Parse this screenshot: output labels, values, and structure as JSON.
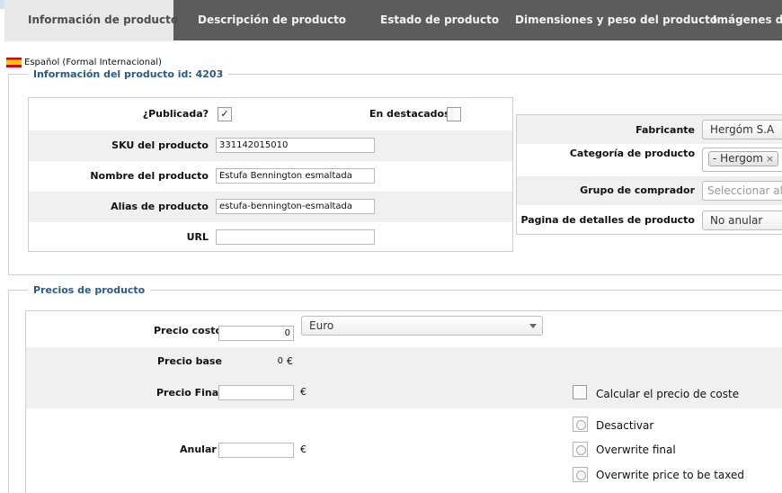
{
  "tabs": [
    {
      "label": "Información de producto",
      "active": true
    },
    {
      "label": "Descripción de producto",
      "active": false
    },
    {
      "label": "Estado de producto",
      "active": false
    },
    {
      "label": "Dimensiones y peso del producto",
      "active": false
    },
    {
      "label": "Imágenes de",
      "active": false
    }
  ],
  "language": {
    "flag_icon": "spain-flag-icon",
    "label": "Español (Formal Internacional)"
  },
  "product_info": {
    "legend": "Información del producto id: 4203",
    "published_label": "¿Publicada?",
    "published_checked": true,
    "featured_label": "En destacados",
    "featured_checked": false,
    "sku_label": "SKU del producto",
    "sku_value": "331142015010",
    "name_label": "Nombre del producto",
    "name_value": "Estufa Bennington esmaltada",
    "alias_label": "Alias de producto",
    "alias_value": "estufa-bennington-esmaltada",
    "url_label": "URL",
    "url_value": ""
  },
  "product_side": {
    "manufacturer_label": "Fabricante",
    "manufacturer_value": "Hergóm S.A",
    "category_label": "Categoría de producto",
    "category_tag": "- Hergom",
    "category_tag_remove": "×",
    "buyer_group_label": "Grupo de comprador",
    "buyer_group_placeholder": "Seleccionar algu",
    "details_page_label": "Pagina de detalles de producto",
    "details_page_value": "No anular"
  },
  "prices": {
    "legend": "Precios de producto",
    "cost_label": "Precio costo",
    "cost_value": "0",
    "currency_value": "Euro",
    "base_label": "Precio base",
    "base_value": "0",
    "euro_symbol": "€",
    "final_label": "Precio Final",
    "final_value": "",
    "calc_cost_label": "Calcular el precio de coste",
    "override_label": "Anular",
    "override_value": "",
    "override_options": [
      "Desactivar",
      "Overwrite final",
      "Overwrite price to be taxed"
    ]
  },
  "colors": {
    "tab_bar": "#5c5c5c",
    "active_tab": "#e9e9e9",
    "legend": "#2a5b86",
    "alt_row": "#f0f0f0"
  }
}
